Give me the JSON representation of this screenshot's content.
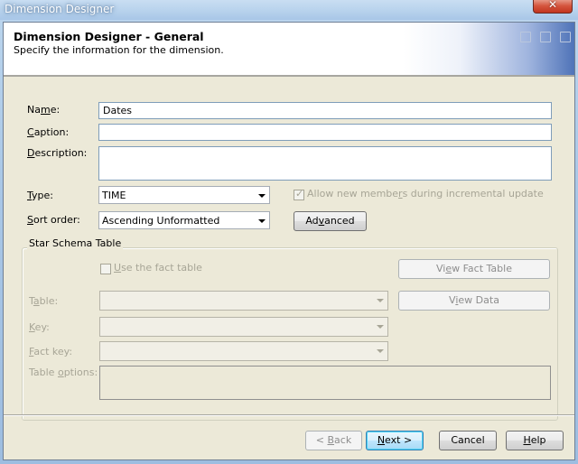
{
  "window": {
    "title": "Dimension Designer",
    "close_icon": "close-x"
  },
  "header": {
    "title": "Dimension Designer - General",
    "subtitle": "Specify the information for the dimension."
  },
  "form": {
    "name": {
      "label_pre": "Na",
      "label_u": "m",
      "label_post": "e:",
      "value": "Dates"
    },
    "caption": {
      "label_pre": "",
      "label_u": "C",
      "label_post": "aption:",
      "value": ""
    },
    "description": {
      "label_pre": "",
      "label_u": "D",
      "label_post": "escription:",
      "value": ""
    },
    "type": {
      "label_pre": "",
      "label_u": "T",
      "label_post": "ype:",
      "value": "TIME"
    },
    "sort_order": {
      "label_pre": "",
      "label_u": "S",
      "label_post": "ort order:",
      "value": "Ascending Unformatted"
    },
    "allow_new_members": {
      "label_pre": "Allow new membe",
      "label_u": "r",
      "label_post": "s during incremental update",
      "checked": true,
      "enabled": false
    },
    "advanced_button": {
      "label_pre": "Ad",
      "label_u": "v",
      "label_post": "anced"
    }
  },
  "star_schema": {
    "title": "Star Schema Table",
    "use_fact_table": {
      "label_pre": "",
      "label_u": "U",
      "label_post": "se the fact table",
      "checked": false,
      "enabled": false
    },
    "view_fact_table_button": {
      "label_pre": "Vi",
      "label_u": "e",
      "label_post": "w Fact Table",
      "enabled": false
    },
    "view_data_button": {
      "label_pre": "V",
      "label_u": "i",
      "label_post": "ew Data",
      "enabled": false
    },
    "table": {
      "label_pre": "T",
      "label_u": "a",
      "label_post": "ble:",
      "value": ""
    },
    "key": {
      "label_pre": "",
      "label_u": "K",
      "label_post": "ey:",
      "value": ""
    },
    "fact_key": {
      "label_pre": "",
      "label_u": "F",
      "label_post": "act key:",
      "value": ""
    },
    "table_options": {
      "label_pre": "Table ",
      "label_u": "o",
      "label_post": "ptions:",
      "value": ""
    }
  },
  "footer": {
    "back": {
      "label_pre": "< ",
      "label_u": "B",
      "label_post": "ack",
      "enabled": false
    },
    "next": {
      "label_pre": "",
      "label_u": "N",
      "label_post": "ext >",
      "enabled": true
    },
    "cancel": {
      "label": "Cancel"
    },
    "help": {
      "label_pre": "",
      "label_u": "H",
      "label_post": "elp"
    }
  }
}
